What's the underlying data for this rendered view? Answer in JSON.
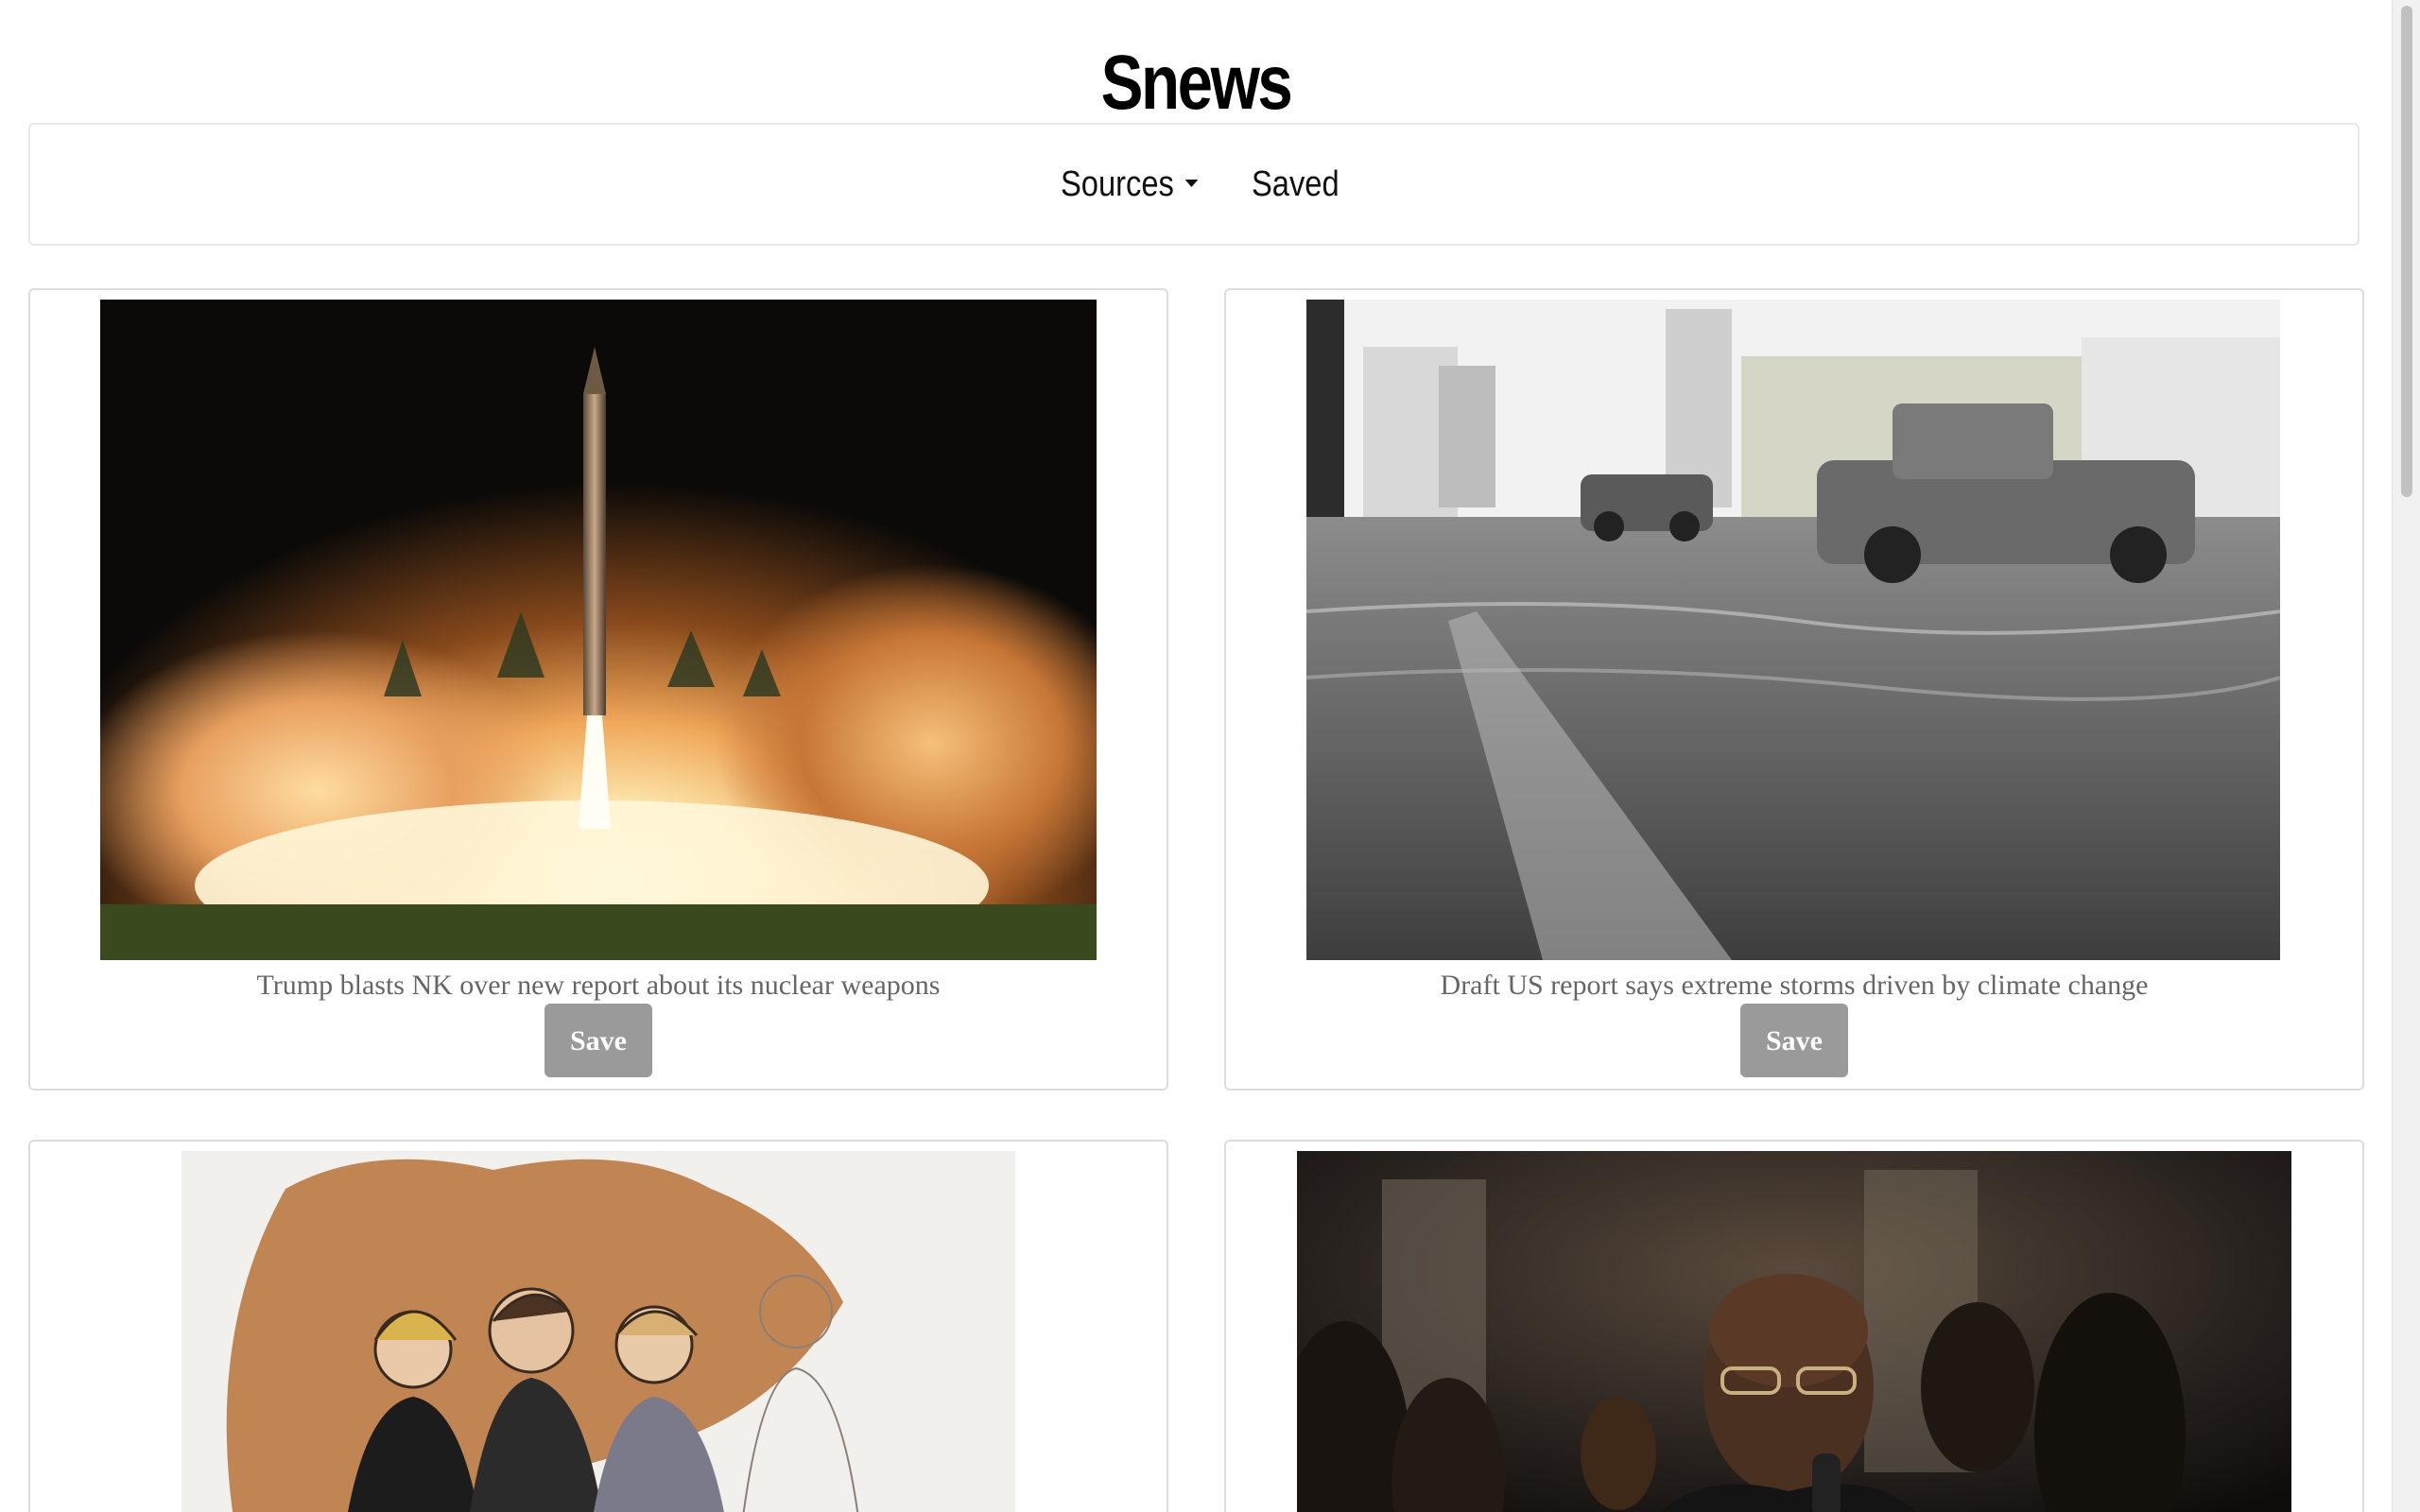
{
  "site": {
    "title": "Snews"
  },
  "nav": {
    "sources_label": "Sources",
    "saved_label": "Saved"
  },
  "articles": [
    {
      "headline": "Trump blasts NK over new report about its nuclear weapons",
      "save_label": "Save",
      "image": "missile launch at night"
    },
    {
      "headline": "Draft US report says extreme storms driven by climate change",
      "save_label": "Save",
      "image": "flooded street with cars"
    },
    {
      "headline": "",
      "save_label": "",
      "image": "courtroom sketch"
    },
    {
      "headline": "",
      "save_label": "",
      "image": "man speaking into microphone"
    }
  ],
  "colors": {
    "save_button_bg": "#9a9a9a",
    "headline_text": "#666666",
    "border": "#dddddd"
  }
}
